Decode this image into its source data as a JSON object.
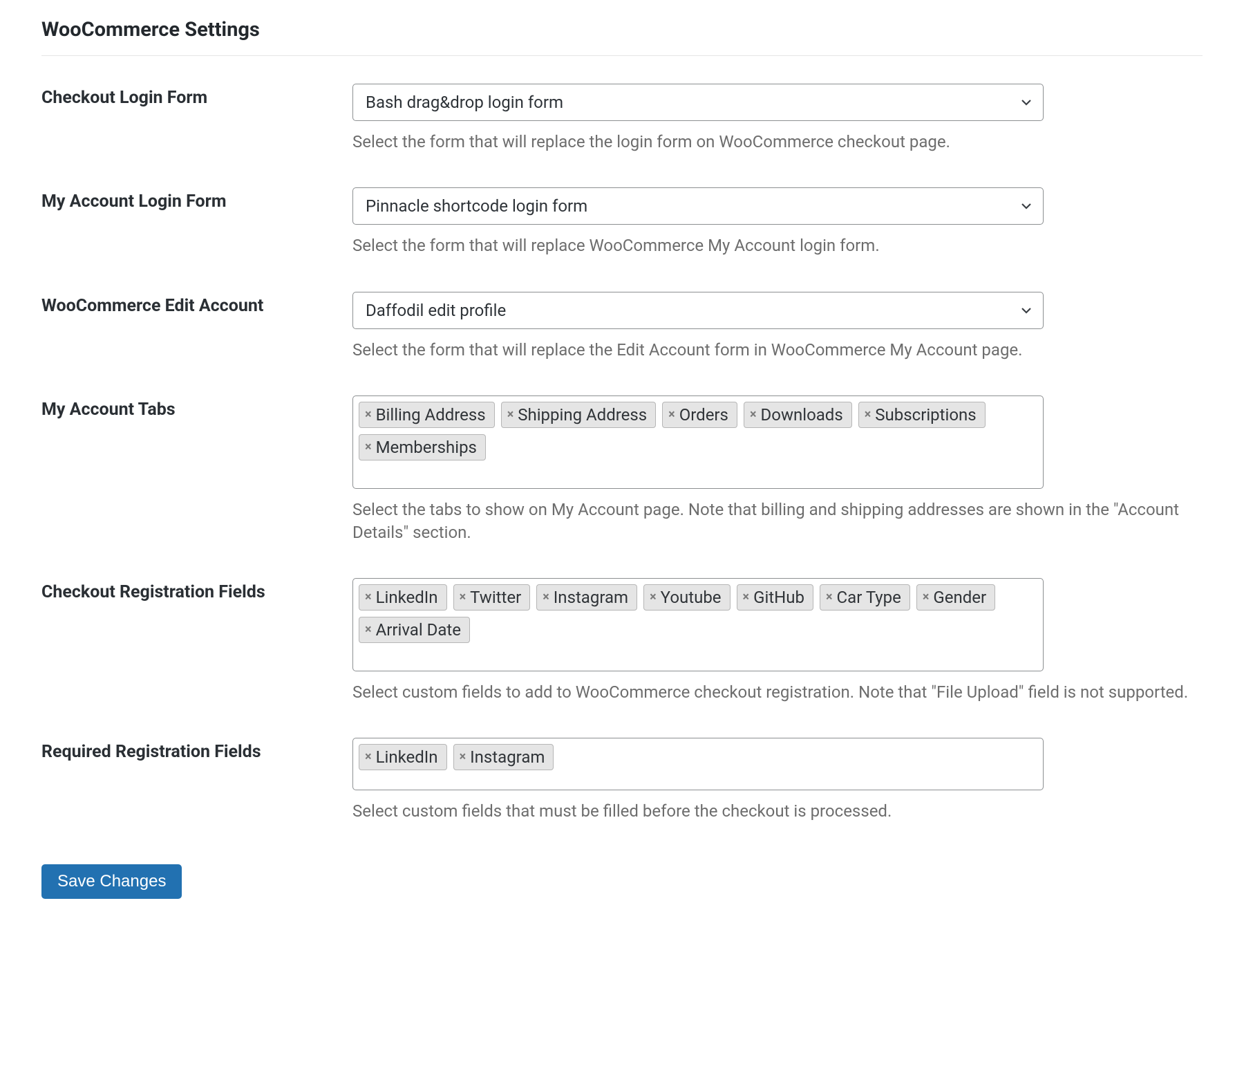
{
  "page": {
    "title": "WooCommerce Settings"
  },
  "fields": {
    "checkout_login_form": {
      "label": "Checkout Login Form",
      "value": "Bash drag&drop login form",
      "description": "Select the form that will replace the login form on WooCommerce checkout page."
    },
    "my_account_login_form": {
      "label": "My Account Login Form",
      "value": "Pinnacle shortcode login form",
      "description": "Select the form that will replace WooCommerce My Account login form."
    },
    "woocommerce_edit_account": {
      "label": "WooCommerce Edit Account",
      "value": "Daffodil edit profile",
      "description": "Select the form that will replace the Edit Account form in WooCommerce My Account page."
    },
    "my_account_tabs": {
      "label": "My Account Tabs",
      "tags": [
        "Billing Address",
        "Shipping Address",
        "Orders",
        "Downloads",
        "Subscriptions",
        "Memberships"
      ],
      "description": "Select the tabs to show on My Account page. Note that billing and shipping addresses are shown in the \"Account Details\" section."
    },
    "checkout_registration_fields": {
      "label": "Checkout Registration Fields",
      "tags": [
        "LinkedIn",
        "Twitter",
        "Instagram",
        "Youtube",
        "GitHub",
        "Car Type",
        "Gender",
        "Arrival Date"
      ],
      "description": "Select custom fields to add to WooCommerce checkout registration. Note that \"File Upload\" field is not supported."
    },
    "required_registration_fields": {
      "label": "Required Registration Fields",
      "tags": [
        "LinkedIn",
        "Instagram"
      ],
      "description": "Select custom fields that must be filled before the checkout is processed."
    }
  },
  "actions": {
    "save": "Save Changes"
  },
  "icons": {
    "remove_glyph": "×"
  }
}
